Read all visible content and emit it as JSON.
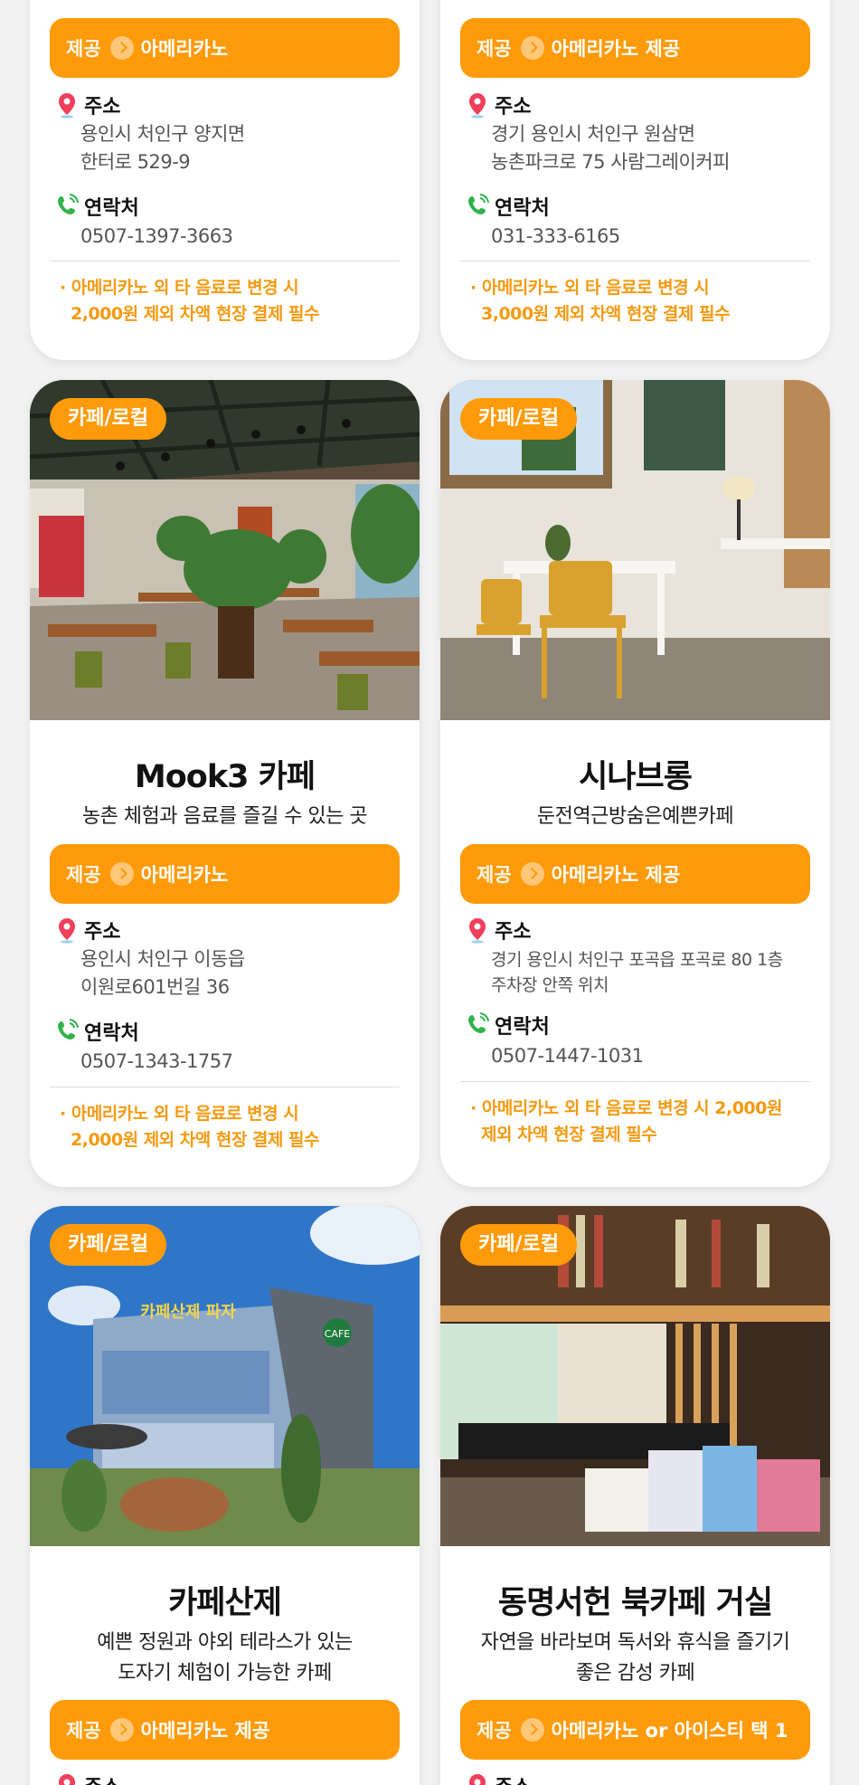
{
  "labels": {
    "offer_prefix": "제공",
    "address": "주소",
    "contact": "연락처"
  },
  "colors": {
    "accent": "#ff9a0a",
    "notice_text": "#f59a12",
    "pin_icon": "#ef3f5b",
    "phone_icon": "#2fb34a"
  },
  "cards": [
    {
      "offer": "아메리카노",
      "address_lines": [
        "용인시 처인구 양지면",
        "한터로 529-9"
      ],
      "phone": "0507-1397-3663",
      "notice_lines": [
        "· 아메리카노 외 타 음료로 변경 시",
        "2,000원 제외 차액 현장 결제 필수"
      ]
    },
    {
      "offer": "아메리카노 제공",
      "address_lines": [
        "경기 용인시 처인구 원삼면",
        "농촌파크로 75 사람그레이커피"
      ],
      "phone": "031-333-6165",
      "notice_lines": [
        "· 아메리카노 외 타 음료로 변경 시",
        "3,000원 제외 차액 현장 결제 필수"
      ]
    },
    {
      "category": "카페/로컬",
      "photo_icon": "cafe-interior-photo",
      "title": "Mook3 카페",
      "subtitle_lines": [
        "농촌 체험과 음료를 즐길 수 있는 곳"
      ],
      "offer": "아메리카노",
      "address_lines": [
        "용인시 처인구 이동읍",
        "이원로601번길 36"
      ],
      "phone": "0507-1343-1757",
      "notice_lines": [
        "· 아메리카노 외 타 음료로 변경 시",
        "2,000원 제외 차액 현장 결제 필수"
      ]
    },
    {
      "category": "카페/로컬",
      "photo_icon": "cafe-corner-photo",
      "title": "시나브롱",
      "subtitle_lines": [
        "둔전역근방숨은예쁜카페"
      ],
      "offer": "아메리카노 제공",
      "address_lines": [
        "경기 용인시 처인구 포곡읍 포곡로 80 1층",
        "주차장 안쪽 위치"
      ],
      "phone": "0507-1447-1031",
      "notice_lines": [
        "· 아메리카노 외 타 음료로 변경 시 2,000원",
        "제외 차액 현장 결제 필수"
      ]
    },
    {
      "category": "카페/로컬",
      "photo_icon": "cafe-building-photo",
      "photo_sign": "카페산제 파자",
      "photo_badge": "CAFE",
      "title": "카페산제",
      "subtitle_lines": [
        "예쁜 정원과 야외 테라스가 있는",
        "도자기 체험이 가능한 카페"
      ],
      "offer": "아메리카노 제공",
      "address_label": "주소"
    },
    {
      "category": "카페/로컬",
      "photo_icon": "book-cafe-photo",
      "title": "동명서헌 북카페 거실",
      "subtitle_lines": [
        "자연을 바라보며 독서와 휴식을 즐기기",
        "좋은 감성 카페"
      ],
      "offer": "아메리카노 or 아이스티 택 1",
      "address_label": "주소"
    }
  ]
}
